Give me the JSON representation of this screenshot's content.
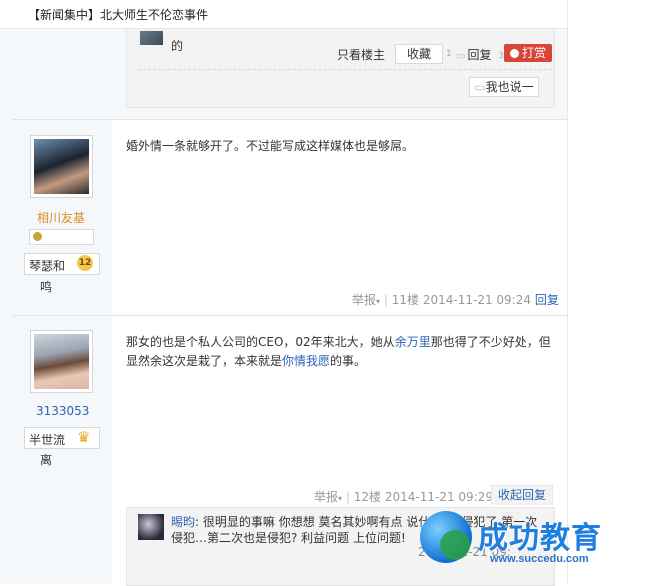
{
  "header": {
    "title": "【新闻集中】北大师生不伦恋事件"
  },
  "top_reply": {
    "text": "的",
    "only_op": "只看楼主",
    "favorite": "收藏",
    "fav_count": "1",
    "reply": "回复",
    "reply_count": "3",
    "tip": "打赏",
    "say_also": "我也说一"
  },
  "posts": [
    {
      "username": "相川友基",
      "badge_name": "琴瑟和鸣",
      "badge_level": "12",
      "content": "婚外情一条就够开了。不过能写成这样媒体也是够屌。",
      "report": "举报",
      "floor": "11楼",
      "time": "2014-11-21 09:24",
      "reply": "回复"
    },
    {
      "username": "3133053",
      "badge_name": "半世流离",
      "content_pre": "那女的也是个私人公司的CEO，02年来北大，她从",
      "link1": "余万里",
      "content_mid": "那也得了不少好处，但显然余这次是栽了，本来就是",
      "link2": "你情我愿",
      "content_post": "的事。",
      "report": "举报",
      "floor": "12楼",
      "time": "2014-11-21 09:29",
      "collapse_reply": "收起回复",
      "sub_reply": {
        "author": "晹昀",
        "text": ": 很明显的事嘛 你想想 莫名其妙啊有点 说什么 ... 侵犯了 第一次侵犯…第二次也是侵犯? 利益问题 上位问题!",
        "time": "2014-11-21 09:"
      }
    }
  ],
  "watermark": {
    "title": "成功教育",
    "url": "www.succedu.com"
  }
}
